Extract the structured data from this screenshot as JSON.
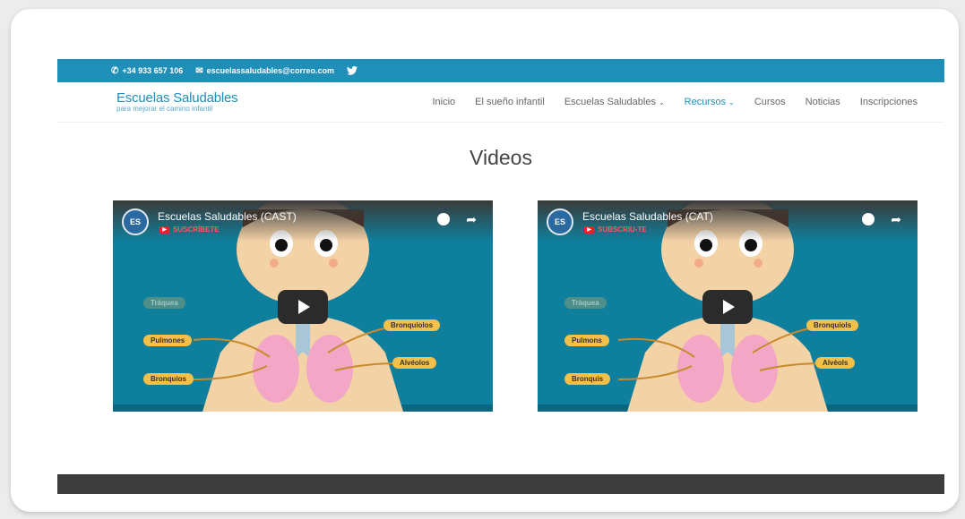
{
  "topbar": {
    "phone": "+34 933 657 106",
    "email": "escuelassaludables@correo.com",
    "twitter_icon": "twitter-icon"
  },
  "logo": {
    "main": "Escuelas Saludables",
    "sub": "para mejorar el camino infantil"
  },
  "nav": {
    "items": [
      {
        "label": "Inicio",
        "has_caret": false,
        "active": false
      },
      {
        "label": "El sueño infantil",
        "has_caret": false,
        "active": false
      },
      {
        "label": "Escuelas Saludables",
        "has_caret": true,
        "active": false
      },
      {
        "label": "Recursos",
        "has_caret": true,
        "active": true
      },
      {
        "label": "Cursos",
        "has_caret": false,
        "active": false
      },
      {
        "label": "Noticias",
        "has_caret": false,
        "active": false
      },
      {
        "label": "Inscripciones",
        "has_caret": false,
        "active": false
      }
    ],
    "caret": "⌄"
  },
  "page": {
    "title": "Videos"
  },
  "videos": [
    {
      "title": "Escuelas Saludables (CAST)",
      "subscribe": "SUSCRÍBETE",
      "labels": {
        "trachea": "Tráquea",
        "lungs": "Pulmones",
        "bronchi": "Bronquios",
        "bronchioles": "Bronquiolos",
        "alveoli": "Alvéolos"
      }
    },
    {
      "title": "Escuelas Saludables (CAT)",
      "subscribe": "SUBSCRIU-TE",
      "labels": {
        "trachea": "Tràquea",
        "lungs": "Pulmons",
        "bronchi": "Bronquis",
        "bronchioles": "Bronquiols",
        "alveoli": "Alvèols"
      }
    }
  ],
  "footer": {
    "text": ""
  },
  "colors": {
    "accent": "#1f8fb8",
    "video_bg": "#0f7f9e",
    "label": "#f3c04a",
    "footer": "#3d3d3d"
  }
}
